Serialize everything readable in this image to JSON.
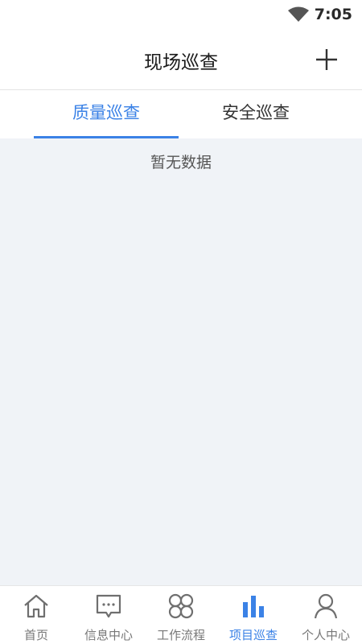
{
  "status_bar": {
    "time": "7:05",
    "wifi_icon": "wifi-icon"
  },
  "header": {
    "title": "现场巡查",
    "add_icon": "plus-icon"
  },
  "tabs": [
    {
      "label": "质量巡查",
      "active": true
    },
    {
      "label": "安全巡查",
      "active": false
    }
  ],
  "content": {
    "empty_text": "暂无数据"
  },
  "bottom_nav": {
    "items": [
      {
        "label": "首页",
        "icon": "home-icon",
        "active": false
      },
      {
        "label": "信息中心",
        "icon": "message-icon",
        "active": false
      },
      {
        "label": "工作流程",
        "icon": "workflow-icon",
        "active": false
      },
      {
        "label": "项目巡查",
        "icon": "bar-chart-icon",
        "active": true
      },
      {
        "label": "个人中心",
        "icon": "person-icon",
        "active": false
      }
    ]
  },
  "colors": {
    "accent": "#3b82e6",
    "background": "#f0f3f7",
    "inactive": "#777777"
  }
}
